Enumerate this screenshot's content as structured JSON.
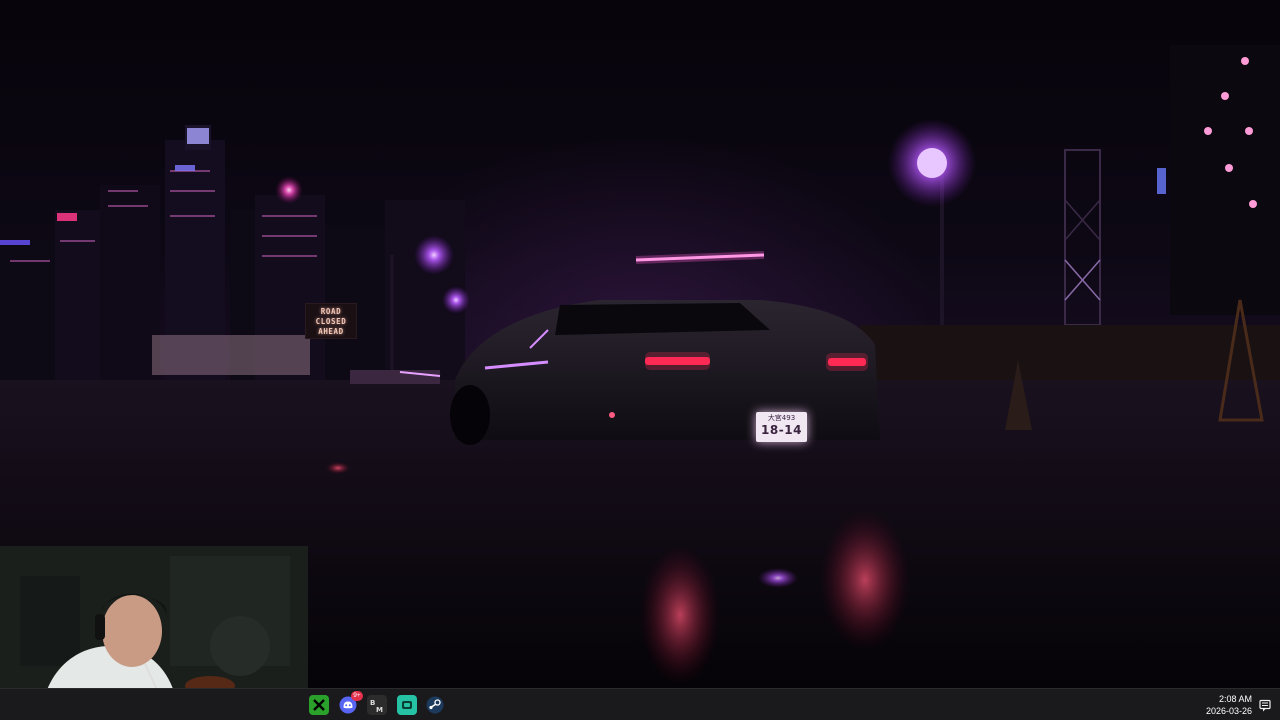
{
  "scene": {
    "road_sign": {
      "line1": "ROAD",
      "line2": "CLOSED",
      "line3": "AHEAD"
    },
    "license_plate": {
      "top": "大宮493",
      "number": "18-14"
    }
  },
  "taskbar": {
    "apps": [
      {
        "name": "Xbox",
        "icon": "xbox-icon",
        "color": "#2aa12a"
      },
      {
        "name": "Discord",
        "icon": "discord-icon",
        "color": "#5865f2",
        "badge": "9+"
      },
      {
        "name": "Battle.net / Media",
        "icon": "bm-icon",
        "color": "#2c2c2c"
      },
      {
        "name": "Game app",
        "icon": "controller-icon",
        "color": "#26c2a5"
      },
      {
        "name": "Steam",
        "icon": "steam-icon",
        "color": "#1b3a5c"
      }
    ],
    "clock": {
      "time": "2:08 AM",
      "date": "2026-03-26"
    },
    "notification_icon": "notification-icon"
  },
  "colors": {
    "neon_purple": "#b85cff",
    "tail_light_red": "#ff2a55",
    "sky": "#0a0610"
  }
}
